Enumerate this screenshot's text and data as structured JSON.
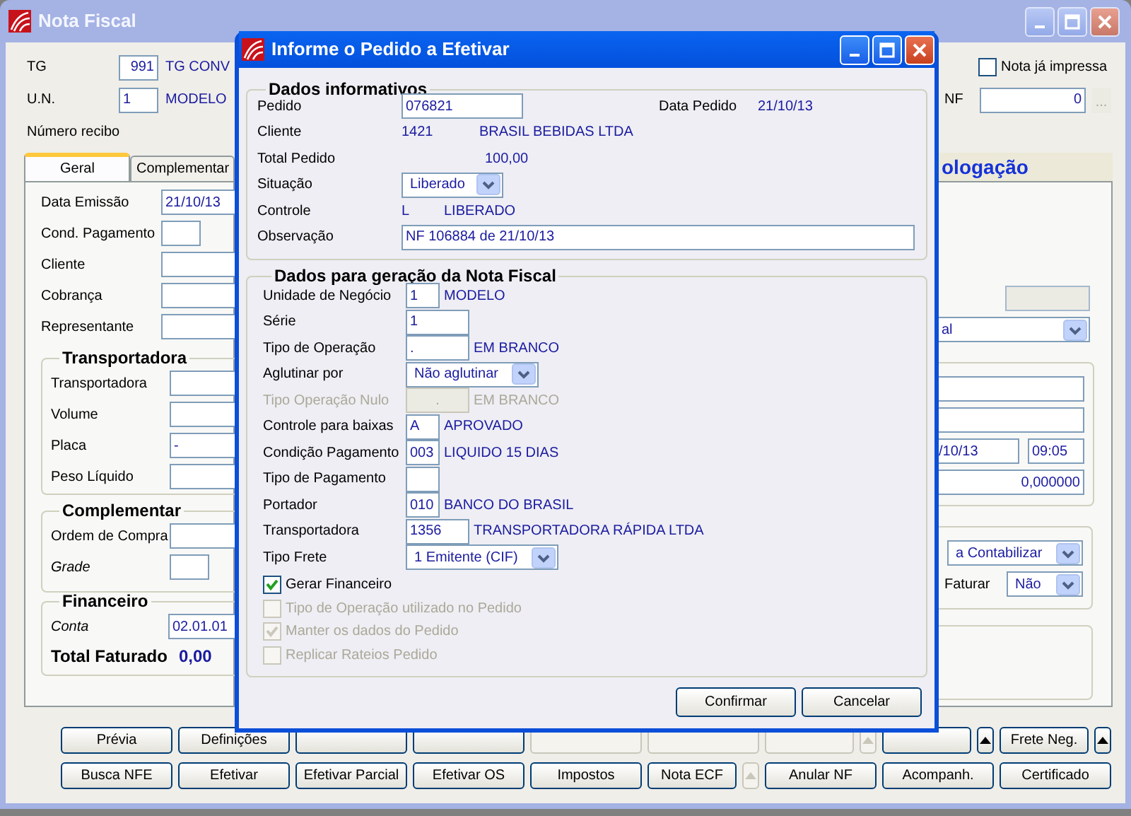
{
  "main_window": {
    "title": "Nota Fiscal"
  },
  "header": {
    "tg": {
      "label": "TG",
      "value": "991",
      "description": "TG CONV"
    },
    "un": {
      "label": "U.N.",
      "value": "1",
      "description": "MODELO"
    },
    "receipt": {
      "label": "Número recibo"
    },
    "printed": {
      "label": "Nota já impressa",
      "checked": false
    },
    "nf": {
      "label": "NF",
      "value": "0",
      "lookup": "..."
    }
  },
  "tabs": [
    {
      "label": "Geral",
      "selected": true
    },
    {
      "label": "Complementar",
      "selected": false
    }
  ],
  "side_heading": "ologação",
  "general_fields": [
    {
      "label": "Data Emissão",
      "kind": "wide",
      "value": "21/10/13"
    },
    {
      "label": "Cond. Pagamento",
      "kind": "short"
    },
    {
      "label": "Cliente",
      "kind": "wide"
    },
    {
      "label": "Cobrança",
      "kind": "wide"
    },
    {
      "label": "Representante",
      "kind": "wide"
    }
  ],
  "groups": [
    {
      "title": "Transportadora",
      "fields": [
        {
          "label": "Transportadora",
          "kind": "wide",
          "italic": false
        },
        {
          "label": "Volume",
          "kind": "wide",
          "italic": false
        },
        {
          "label": "Placa",
          "kind": "wide",
          "italic": false,
          "value": "-"
        },
        {
          "label": "Peso Líquido",
          "kind": "wide",
          "italic": false
        }
      ]
    },
    {
      "title": "Complementar",
      "fields": [
        {
          "label": "Ordem de Compra",
          "kind": "wide",
          "italic": false
        },
        {
          "label": "Grade",
          "kind": "short",
          "italic": true
        }
      ]
    },
    {
      "title": "Financeiro",
      "fields": [
        {
          "label": "Conta",
          "kind": "wide",
          "italic": true,
          "value": "02.01.01"
        }
      ],
      "total": {
        "label": "Total Faturado",
        "value": "0,00"
      }
    }
  ],
  "right_panel": {
    "locked_field": {
      "disabled": true
    },
    "type_select": {
      "value": "al"
    },
    "transport_fields": [
      {
        "kind": "blank"
      },
      {
        "kind": "blank"
      },
      {
        "kind": "datetime",
        "date": "/10/13",
        "time": "09:05"
      },
      {
        "kind": "number",
        "value": "0,000000"
      }
    ],
    "status_select": {
      "value": "a Contabilizar"
    },
    "faturar": {
      "label": "Faturar",
      "value": "Não"
    }
  },
  "buttons_row_1": [
    {
      "label": "Prévia",
      "kind": "normal",
      "disabled": false
    },
    {
      "label": "Definições",
      "kind": "normal",
      "disabled": false
    },
    {
      "kind": "normal",
      "disabled": false
    },
    {
      "kind": "normal",
      "disabled": false
    },
    {
      "kind": "normal",
      "disabled": true
    },
    {
      "kind": "normal",
      "disabled": true
    },
    {
      "kind": "narrow",
      "disabled": true
    },
    {
      "kind": "arrow",
      "disabled": true
    },
    {
      "kind": "narrow",
      "disabled": false
    },
    {
      "kind": "arrow",
      "disabled": false
    },
    {
      "label": "Frete Neg.",
      "kind": "narrow",
      "disabled": false
    },
    {
      "kind": "arrow",
      "disabled": false
    }
  ],
  "buttons_row_2": [
    {
      "label": "Busca NFE",
      "kind": "normal",
      "disabled": false
    },
    {
      "label": "Efetivar",
      "kind": "normal",
      "disabled": false
    },
    {
      "label": "Efetivar Parcial",
      "kind": "normal",
      "disabled": false
    },
    {
      "label": "Efetivar OS",
      "kind": "normal",
      "disabled": false
    },
    {
      "label": "Impostos",
      "kind": "normal",
      "disabled": false
    },
    {
      "label": "Nota ECF",
      "kind": "narrow",
      "disabled": false
    },
    {
      "kind": "arrow",
      "disabled": true
    },
    {
      "label": "Anular NF",
      "kind": "normal",
      "disabled": false
    },
    {
      "label": "Acompanh.",
      "kind": "normal",
      "disabled": false
    },
    {
      "label": "Certificado",
      "kind": "normal",
      "disabled": false
    }
  ],
  "dialog": {
    "title": "Informe o Pedido a Efetivar",
    "info_group": {
      "title": "Dados informativos",
      "pedido": {
        "label": "Pedido",
        "value": "076821"
      },
      "data_pedido": {
        "label": "Data Pedido",
        "value": "21/10/13"
      },
      "cliente": {
        "label": "Cliente",
        "code": "1421",
        "name": "BRASIL BEBIDAS LTDA"
      },
      "total": {
        "label": "Total Pedido",
        "value": "100,00"
      },
      "situacao": {
        "label": "Situação",
        "value": "Liberado"
      },
      "controle": {
        "label": "Controle",
        "code": "L",
        "name": "LIBERADO"
      },
      "observacao": {
        "label": "Observação",
        "value": "NF 106884 de 21/10/13"
      }
    },
    "nf_group": {
      "title": "Dados para geração da Nota Fiscal",
      "rows": [
        {
          "label": "Unidade de Negócio",
          "kind": "short",
          "value": "1",
          "description": "MODELO",
          "disabled": false
        },
        {
          "label": "Série",
          "kind": "medium",
          "value": "1",
          "disabled": false
        },
        {
          "label": "Tipo de Operação",
          "kind": "medium",
          "value": ".",
          "description": "EM BRANCO",
          "disabled": false
        },
        {
          "label": "Aglutinar por",
          "kind": "select",
          "value": "Não aglutinar",
          "disabled": false
        },
        {
          "label": "Tipo Operação Nulo",
          "kind": "medium",
          "value": ".",
          "description": "EM BRANCO",
          "disabled": true
        },
        {
          "label": "Controle para baixas",
          "kind": "short",
          "value": "A",
          "description": "APROVADO",
          "disabled": false
        },
        {
          "label": "Condição Pagamento",
          "kind": "short",
          "value": "003",
          "description": "LIQUIDO 15 DIAS",
          "disabled": false
        },
        {
          "label": "Tipo de Pagamento",
          "kind": "short",
          "disabled": false
        },
        {
          "label": "Portador",
          "kind": "short",
          "value": "010",
          "description": "BANCO DO BRASIL",
          "disabled": false
        },
        {
          "label": "Transportadora",
          "kind": "medium",
          "value": "1356",
          "description": "TRANSPORTADORA RÁPIDA LTDA",
          "disabled": false
        },
        {
          "label": "Tipo Frete",
          "kind": "select",
          "value": "1 Emitente (CIF)",
          "disabled": false
        }
      ],
      "checks": [
        {
          "label": "Gerar Financeiro",
          "checked": true,
          "disabled": false
        },
        {
          "label": "Tipo de Operação utilizado no Pedido",
          "checked": false,
          "disabled": true
        },
        {
          "label": "Manter os dados do Pedido",
          "checked": true,
          "disabled": true
        },
        {
          "label": "Replicar Rateios Pedido",
          "checked": false,
          "disabled": true
        }
      ]
    },
    "buttons": [
      {
        "label": "Confirmar"
      },
      {
        "label": "Cancelar"
      }
    ]
  }
}
